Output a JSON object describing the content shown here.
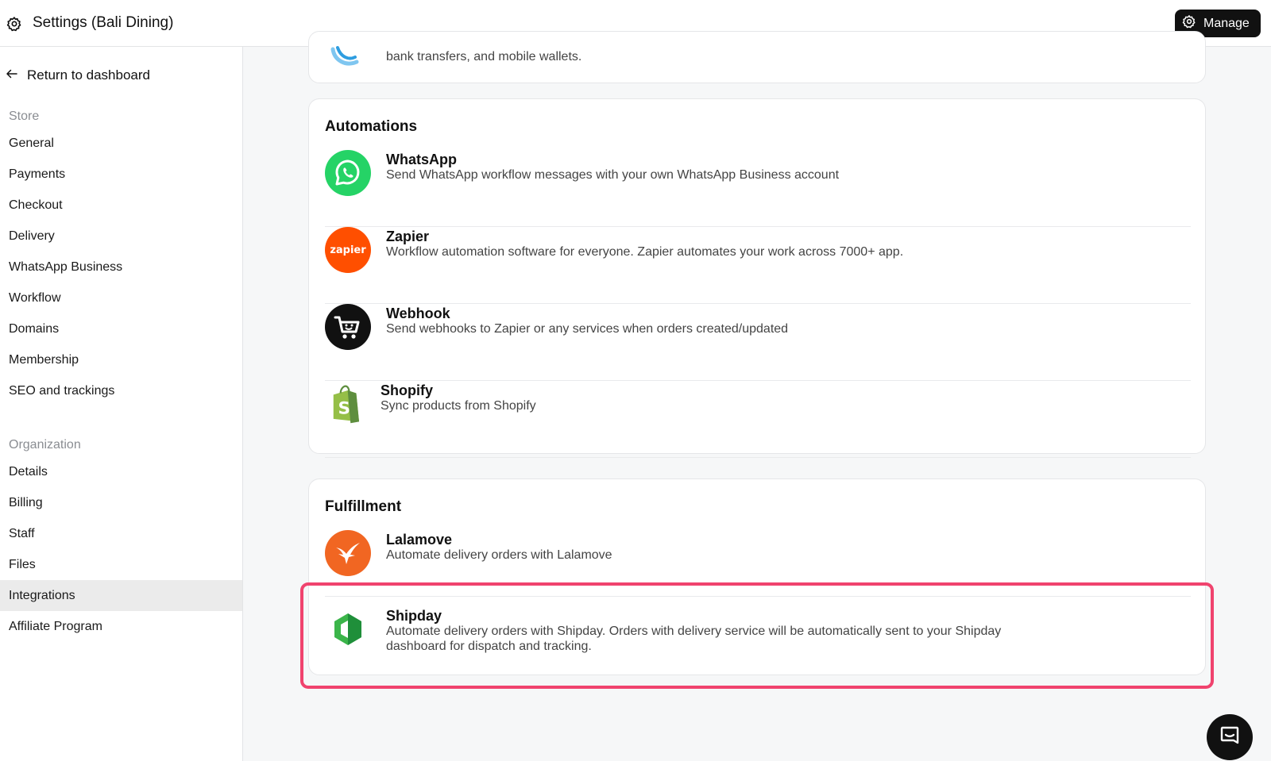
{
  "header": {
    "title": "Settings (Bali Dining)",
    "manage_label": "Manage"
  },
  "sidebar": {
    "back_label": "Return to dashboard",
    "store_label": "Store",
    "store_items": [
      "General",
      "Payments",
      "Checkout",
      "Delivery",
      "WhatsApp Business",
      "Workflow",
      "Domains",
      "Membership",
      "SEO and trackings"
    ],
    "org_label": "Organization",
    "org_items": [
      "Details",
      "Billing",
      "Staff",
      "Files",
      "Integrations",
      "Affiliate Program"
    ],
    "active_item": "Integrations"
  },
  "payments_card": {
    "partial_text": "bank transfers, and mobile wallets."
  },
  "automations": {
    "title": "Automations",
    "items": [
      {
        "name": "WhatsApp",
        "desc": "Send WhatsApp workflow messages with your own WhatsApp Business account",
        "logo": "whatsapp-icon",
        "color": "#25d366"
      },
      {
        "name": "Zapier",
        "desc": "Workflow automation software for everyone. Zapier automates your work across 7000+ app.",
        "logo": "zapier-icon",
        "logo_text": "zapier",
        "color": "#ff4f00"
      },
      {
        "name": "Webhook",
        "desc": "Send webhooks to Zapier or any services when orders created/updated",
        "logo": "webhook-cart-icon",
        "color": "#111111"
      },
      {
        "name": "Shopify",
        "desc": "Sync products from Shopify",
        "logo": "shopify-icon",
        "color": "#95bf47"
      }
    ]
  },
  "fulfillment": {
    "title": "Fulfillment",
    "items": [
      {
        "name": "Lalamove",
        "desc": "Automate delivery orders with Lalamove",
        "logo": "lalamove-icon",
        "color": "#f16622"
      },
      {
        "name": "Shipday",
        "desc": "Automate delivery orders with Shipday. Orders with delivery service will be automatically sent to your Shipday dashboard for dispatch and tracking.",
        "logo": "shipday-icon",
        "color": "#3bb54a"
      }
    ]
  },
  "colors": {
    "highlight": "#f0436e",
    "active_nav": "#ebebeb",
    "manage_bg": "#111111"
  }
}
